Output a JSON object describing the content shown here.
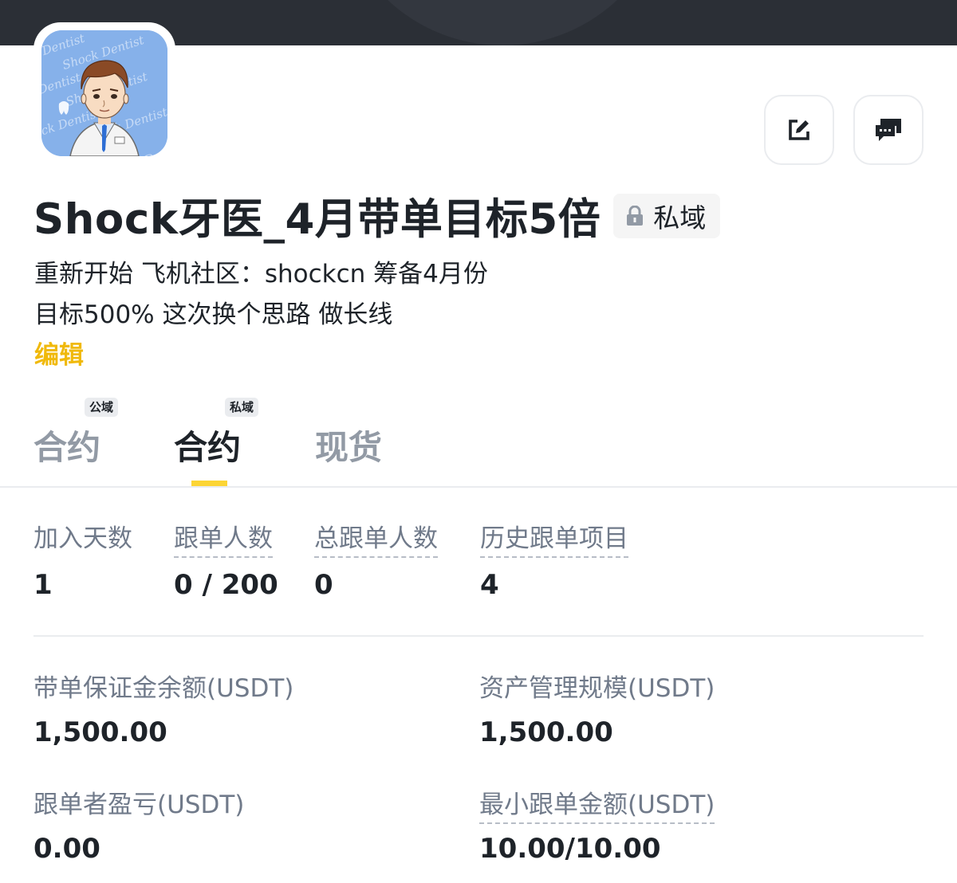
{
  "profile": {
    "name": "Shock牙医_4月带单目标5倍",
    "privacy_badge": "私域",
    "bio_line1": "重新开始 飞机社区：shockcn  筹备4月份",
    "bio_line2": "目标500% 这次换个思路 做长线",
    "edit_link": "编辑",
    "avatar_watermark": "Shock Dentist"
  },
  "tabs": [
    {
      "label": "合约",
      "tag": "公域",
      "active": false
    },
    {
      "label": "合约",
      "tag": "私域",
      "active": true
    },
    {
      "label": "现货",
      "tag": "",
      "active": false
    }
  ],
  "stats": [
    {
      "label": "加入天数",
      "value": "1"
    },
    {
      "label": "跟单人数",
      "value": "0 / 200"
    },
    {
      "label": "总跟单人数",
      "value": "0"
    },
    {
      "label": "历史跟单项目",
      "value": "4"
    }
  ],
  "metrics": {
    "margin_balance": {
      "label": "带单保证金余额(USDT)",
      "value": "1,500.00"
    },
    "aum": {
      "label": "资产管理规模(USDT)",
      "value": "1,500.00"
    },
    "follower_pnl": {
      "label": "跟单者盈亏(USDT)",
      "value": "0.00"
    },
    "min_copy_amount": {
      "label": "最小跟单金额(USDT)",
      "value": "10.00/10.00"
    }
  },
  "icons": {
    "edit": "edit-icon",
    "message": "message-icon",
    "lock": "lock-icon"
  },
  "colors": {
    "accent": "#fcd535",
    "link": "#f0b90b",
    "text_primary": "#1e2329",
    "text_secondary": "#707a8a"
  }
}
